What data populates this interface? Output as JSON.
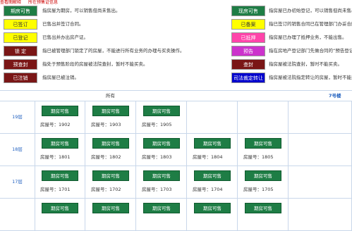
{
  "topbar": {
    "left": "查看图解释",
    "right": "所在预售证信息"
  },
  "legend_left": [
    {
      "label": "期房可售",
      "bg": "#1e7d45",
      "fg": "#ffffff",
      "desc": "指房屋为期房，可以销售但尚未售出。"
    },
    {
      "label": "已签订",
      "bg": "#ffff00",
      "fg": "#333333",
      "desc": "已售出并签订合同。"
    },
    {
      "label": "已登记",
      "bg": "#ffff00",
      "fg": "#333333",
      "desc": "已售出并办出房产证。"
    },
    {
      "label": "锁 定",
      "bg": "#7a1616",
      "fg": "#ffffff",
      "desc": "指已被管理部门锁定了的房屋，不能进行所有业务的办理与买卖操作。"
    },
    {
      "label": "预查封",
      "bg": "#7a1616",
      "fg": "#ffffff",
      "desc": "指处于预售阶段的房屋被法院查封，暂时不能买卖。"
    },
    {
      "label": "已注销",
      "bg": "#7a1616",
      "fg": "#ffffff",
      "desc": "指房屋已被注销。"
    }
  ],
  "legend_right": [
    {
      "label": "现房可售",
      "bg": "#1e7d45",
      "fg": "#ffffff",
      "desc": "指房屋已办初始登记，可以销售但尚未售出。"
    },
    {
      "label": "已备案",
      "bg": "#ffff00",
      "fg": "#333333",
      "desc": "指已签订的销售合同已在管理部门办妥合同备案。"
    },
    {
      "label": "已抵押",
      "bg": "#ff44aa",
      "fg": "#ffffff",
      "desc": "指房屋已办理了抵押业务，不能出售。"
    },
    {
      "label": "预告",
      "bg": "#cc33cc",
      "fg": "#ffffff",
      "desc": "指在房地产登记部门先做合同的“预告登记”。"
    },
    {
      "label": "查封",
      "bg": "#7a1616",
      "fg": "#ffffff",
      "desc": "指房屋被法院查封，暂时不能买卖。"
    },
    {
      "label": "司法裁定转让",
      "bg": "#0000cc",
      "fg": "#ffffff",
      "desc": "指房屋被法院指定转让的房屋，暂时不能买卖。"
    }
  ],
  "grid": {
    "all_label": "所有",
    "building_label": "7号楼"
  },
  "floors": [
    {
      "floor": "19层",
      "units": [
        {
          "status": "期房可售",
          "room": "房屋号：1902"
        },
        {
          "status": "期房可售",
          "room": "房屋号：1903"
        },
        {
          "status": "期房可售",
          "room": "房屋号：1905"
        },
        null,
        null,
        null
      ]
    },
    {
      "floor": "18层",
      "units": [
        {
          "status": "期房可售",
          "room": "房屋号：1801"
        },
        {
          "status": "期房可售",
          "room": "房屋号：1802"
        },
        {
          "status": "期房可售",
          "room": "房屋号：1803"
        },
        {
          "status": "期房可售",
          "room": "房屋号：1804"
        },
        {
          "status": "期房可售",
          "room": "房屋号：1805"
        },
        null
      ]
    },
    {
      "floor": "17层",
      "units": [
        {
          "status": "期房可售",
          "room": "房屋号：1701"
        },
        {
          "status": "期房可售",
          "room": "房屋号：1702"
        },
        {
          "status": "期房可售",
          "room": "房屋号：1703"
        },
        {
          "status": "期房可售",
          "room": "房屋号：1704"
        },
        {
          "status": "期房可售",
          "room": "房屋号：1705"
        },
        null
      ]
    },
    {
      "floor": "",
      "units": [
        {
          "status": "期房可售",
          "room": ""
        },
        {
          "status": "期房可售",
          "room": ""
        },
        {
          "status": "期房可售",
          "room": ""
        },
        {
          "status": "期房可售",
          "room": ""
        },
        {
          "status": "期房可售",
          "room": ""
        },
        null
      ]
    }
  ]
}
